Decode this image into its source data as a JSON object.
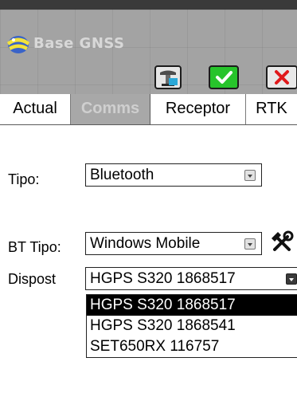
{
  "window": {
    "title": "Base GNSS",
    "toolbar": {
      "receiver_icon": "receiver-settings-icon",
      "ok_icon": "checkmark-icon",
      "cancel_icon": "close-icon"
    }
  },
  "tabs": [
    {
      "label": "Actual"
    },
    {
      "label": "Comms",
      "active": true
    },
    {
      "label": "Receptor"
    },
    {
      "label": "RTK"
    }
  ],
  "form": {
    "tipo": {
      "label": "Tipo:",
      "value": "Bluetooth"
    },
    "bt_tipo": {
      "label": "BT Tipo:",
      "value": "Windows Mobile"
    },
    "dispost": {
      "label": "Dispost",
      "value": "HGPS S320 1868517",
      "options": [
        "HGPS S320 1868517",
        "HGPS S320 1868541",
        "SET650RX 116757"
      ],
      "selected_index": 0
    }
  },
  "colors": {
    "title_bar": "#a3a3a3",
    "ok_button": "#27c42b",
    "cancel_x": "#e0191b",
    "active_tab": "#a8a8a8"
  }
}
